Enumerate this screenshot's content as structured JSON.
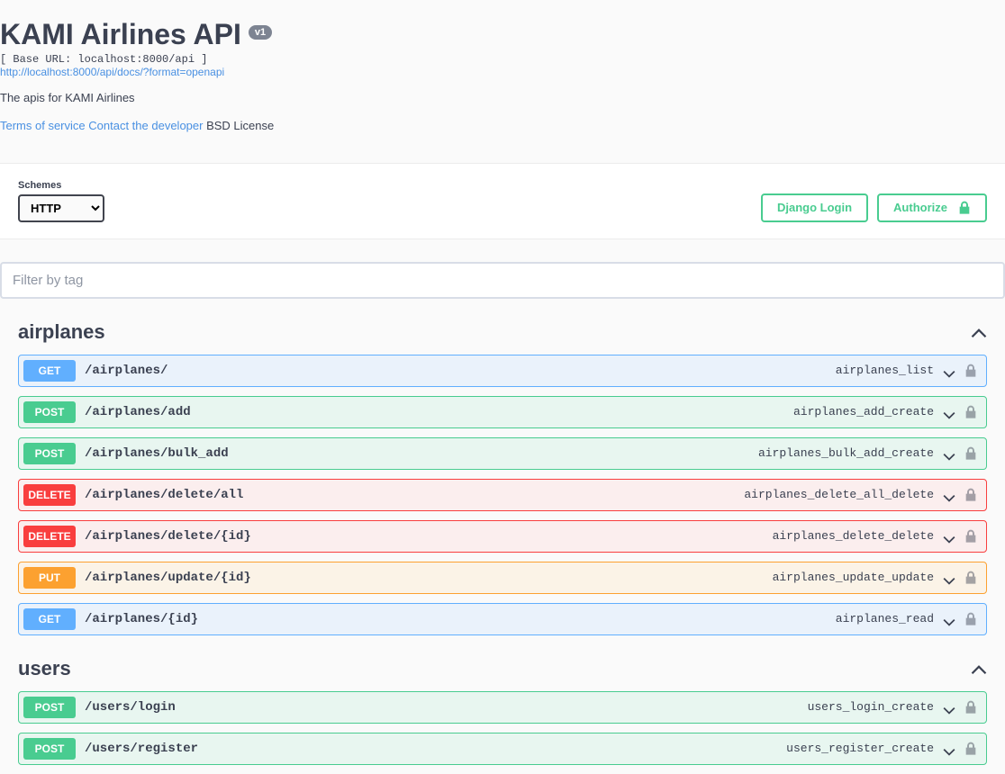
{
  "header": {
    "title": "KAMI Airlines API",
    "version": "v1",
    "base_url": "[ Base URL: localhost:8000/api ]",
    "docs_link": "http://localhost:8000/api/docs/?format=openapi",
    "description": "The apis for KAMI Airlines",
    "terms": "Terms of service",
    "contact": "Contact the developer",
    "license": "BSD License"
  },
  "topbar": {
    "schemes_label": "Schemes",
    "scheme_options": [
      "HTTP"
    ],
    "scheme_selected": "HTTP",
    "django_login": "Django Login",
    "authorize": "Authorize"
  },
  "filter": {
    "placeholder": "Filter by tag"
  },
  "tags": [
    {
      "name": "airplanes",
      "ops": [
        {
          "method": "GET",
          "path": "/airplanes/",
          "id": "airplanes_list"
        },
        {
          "method": "POST",
          "path": "/airplanes/add",
          "id": "airplanes_add_create"
        },
        {
          "method": "POST",
          "path": "/airplanes/bulk_add",
          "id": "airplanes_bulk_add_create"
        },
        {
          "method": "DELETE",
          "path": "/airplanes/delete/all",
          "id": "airplanes_delete_all_delete"
        },
        {
          "method": "DELETE",
          "path": "/airplanes/delete/{id}",
          "id": "airplanes_delete_delete"
        },
        {
          "method": "PUT",
          "path": "/airplanes/update/{id}",
          "id": "airplanes_update_update"
        },
        {
          "method": "GET",
          "path": "/airplanes/{id}",
          "id": "airplanes_read"
        }
      ]
    },
    {
      "name": "users",
      "ops": [
        {
          "method": "POST",
          "path": "/users/login",
          "id": "users_login_create"
        },
        {
          "method": "POST",
          "path": "/users/register",
          "id": "users_register_create"
        }
      ]
    }
  ]
}
